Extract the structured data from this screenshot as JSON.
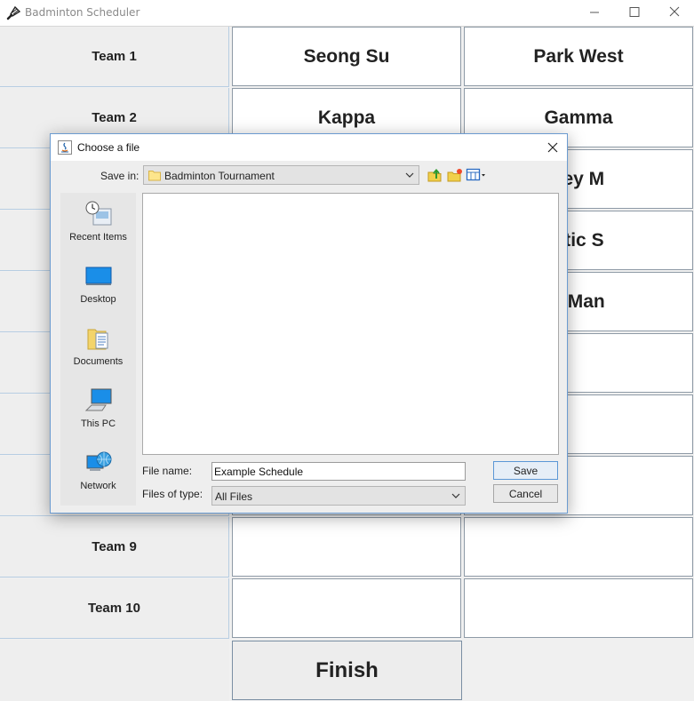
{
  "app": {
    "title": "Badminton Scheduler",
    "icon": "shuttlecock-icon"
  },
  "teams": [
    {
      "label": "Team 1",
      "player1": "Seong Su",
      "player2": "Park West"
    },
    {
      "label": "Team 2",
      "player1": "Kappa",
      "player2": "Gamma"
    },
    {
      "label": "",
      "player1": "",
      "player2": "sey M"
    },
    {
      "label": "",
      "player1": "",
      "player2": "ntic S"
    },
    {
      "label": "",
      "player1": "",
      "player2": "k Man"
    },
    {
      "label": "",
      "player1": "",
      "player2": ""
    },
    {
      "label": "",
      "player1": "",
      "player2": ""
    },
    {
      "label": "",
      "player1": "",
      "player2": ""
    },
    {
      "label": "Team 9",
      "player1": "",
      "player2": ""
    },
    {
      "label": "Team 10",
      "player1": "",
      "player2": ""
    }
  ],
  "finish_label": "Finish",
  "dialog": {
    "title": "Choose a file",
    "save_in_label": "Save in:",
    "current_folder": "Badminton Tournament",
    "places": [
      {
        "label": "Recent Items",
        "icon": "recent-items-icon"
      },
      {
        "label": "Desktop",
        "icon": "desktop-icon"
      },
      {
        "label": "Documents",
        "icon": "documents-icon"
      },
      {
        "label": "This PC",
        "icon": "computer-icon"
      },
      {
        "label": "Network",
        "icon": "network-icon"
      }
    ],
    "file_name_label": "File name:",
    "file_name_value": "Example Schedule",
    "files_of_type_label": "Files of type:",
    "files_of_type_value": "All Files",
    "save_label": "Save",
    "cancel_label": "Cancel"
  },
  "colors": {
    "dialog_border": "#6b9bd0",
    "grid_line": "#b7cde2",
    "cell_border": "#8e9aa6"
  }
}
